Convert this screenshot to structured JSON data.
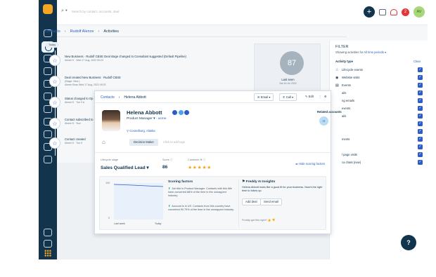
{
  "topbar": {
    "search_placeholder": "Search by contact, accounts, deal",
    "plus_label": "+",
    "notif_count": "2",
    "avatar_initials": "AV"
  },
  "breadcrumb": {
    "root": "Contacts",
    "person": "Rudolf Alenov",
    "page": "Activities"
  },
  "feed": {
    "today_label": "Today",
    "items": [
      {
        "line1_prefix": "New Business · Rudolf CBSE Deal stage changed to Consultant suggested (Default Pipeline)",
        "line2": "Aimee K · Wed 17 Aug, 2022 09:23",
        "line3": ""
      },
      {
        "line1_prefix": "Deal created New Business · Rudolf CBSE",
        "line2": "(Stage: New )",
        "line3": "Aimee Khan Wed 17 Aug, 2022 09:23"
      },
      {
        "line1_prefix": "Status changed to Op",
        "line2": "Aimee K · Tue 9 A",
        "line3": ""
      },
      {
        "line1_prefix": "Contact subscribed to",
        "line2": "Aimee K · Sun",
        "line3": ""
      },
      {
        "line1_prefix": "Contact created",
        "line2": "Aimee K · Tue 9",
        "line3": ""
      }
    ]
  },
  "score": {
    "value": "87",
    "last_seen_label": "Last seen",
    "last_seen_date": "Sat 16 Jul 2022"
  },
  "filter": {
    "title": "FILTER",
    "showing_prefix": "Showing activities for",
    "period": "All time periods ▾",
    "activity_type_label": "Activity type",
    "clear_label": "Clear",
    "rows": [
      {
        "icon": "☆",
        "label": "Lifecycle events"
      },
      {
        "icon": "◉",
        "label": "Website visits"
      },
      {
        "icon": "▤",
        "label": "Events"
      },
      {
        "icon": "",
        "label": "ails"
      },
      {
        "icon": "",
        "label": "ng emails"
      },
      {
        "icon": "",
        "label": "events"
      },
      {
        "icon": "",
        "label": "ails"
      },
      {
        "icon": "",
        "label": ""
      },
      {
        "icon": "",
        "label": ""
      },
      {
        "icon": "",
        "label": "ments"
      },
      {
        "icon": "",
        "label": ""
      },
      {
        "icon": "",
        "label": "l page visits"
      },
      {
        "icon": "",
        "label": "ca chats (new)"
      }
    ]
  },
  "card": {
    "crumb_root": "Contacts",
    "crumb_name": "Helena Abbott",
    "email_btn": "Email",
    "call_btn": "Call",
    "edit_btn": "Edit",
    "name": "Helena Abbott",
    "role": "Product Manager",
    "company": "acme",
    "location": "Connelburg, Alaska",
    "tag_button": "Decision Maker",
    "add_tags": "Click to add tags",
    "related_title": "Related accounts",
    "related_initials": "AI",
    "lifecycle_label": "Lifecycle stage",
    "lifecycle_value": "Sales Qualified Lead",
    "score_label": "Score",
    "score_value": "86",
    "fit_label": "Customer fit",
    "fit_stars": 5,
    "hide_scoring": "Hide scoring factors",
    "spark": {
      "y_top": "100",
      "y_bottom": "0",
      "x_left": "Last week",
      "x_right": "Today"
    },
    "scoring_title": "Scoring factors",
    "scoring_items": [
      "Job title is Product Manager. Contacts with this title have converted 88% of the time in the unmapped industry.",
      "Account is in US. Contacts from this country have converted 90.79% of the time in the unmapped industry."
    ],
    "ai_title": "Freddy AI Insights",
    "ai_text": "Helena Abbott looks like a good fit for your business. Now's the right time to follow up.",
    "ai_add_deal": "Add deal",
    "ai_send_email": "Send email",
    "ai_question": "Freddy got this right?"
  },
  "help_label": "?"
}
